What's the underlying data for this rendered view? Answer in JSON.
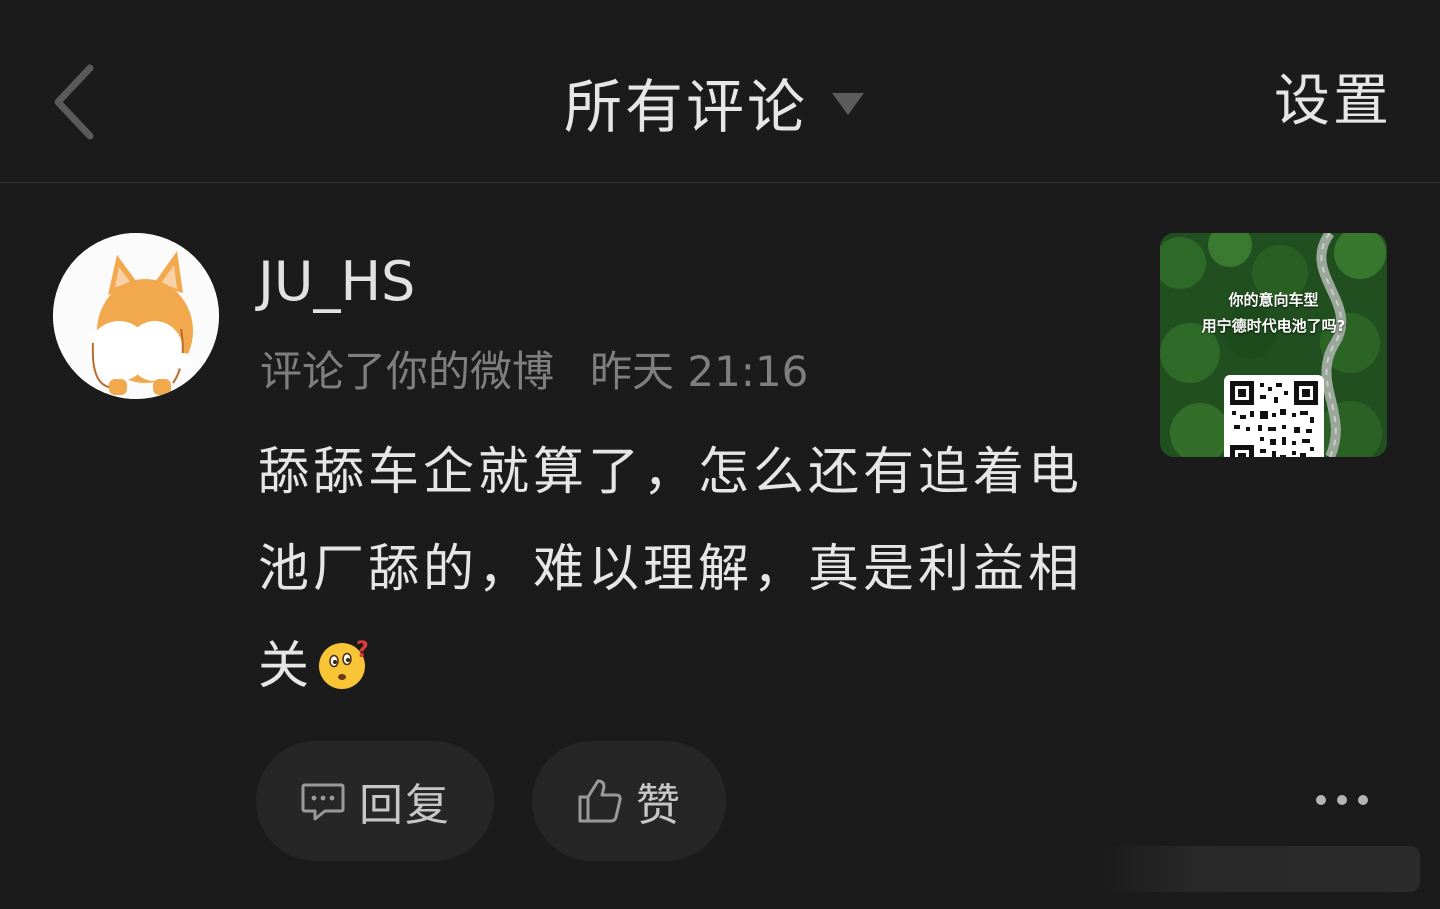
{
  "header": {
    "title": "所有评论",
    "settings_label": "设置"
  },
  "comment": {
    "username": "JU_HS",
    "action_text": "评论了你的微博",
    "time": "昨天 21:16",
    "content": "舔舔车企就算了，怎么还有追着电池厂舔的，难以理解，真是利益相关",
    "emoji": "thinking-face-emoji"
  },
  "thumbnail": {
    "line1": "你的意向车型",
    "line2": "用宁德时代电池了吗?"
  },
  "actions": {
    "reply_label": "回复",
    "like_label": "赞"
  },
  "colors": {
    "background": "#1b1b1b",
    "primary_text": "#e6e6e6",
    "secondary_text": "#7f7f7f",
    "button_bg": "#262626"
  }
}
